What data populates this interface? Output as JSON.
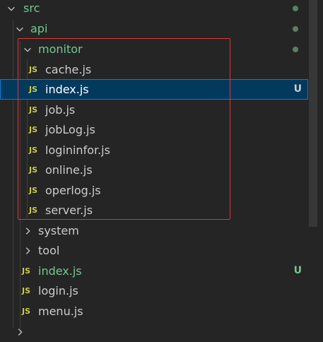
{
  "explorer": {
    "folders": {
      "src": "src",
      "api": "api",
      "monitor": "monitor",
      "system": "system",
      "tool": "tool"
    },
    "monitor_files": [
      {
        "name": "cache.js"
      },
      {
        "name": "index.js",
        "status": "U"
      },
      {
        "name": "job.js"
      },
      {
        "name": "jobLog.js"
      },
      {
        "name": "logininfor.js"
      },
      {
        "name": "online.js"
      },
      {
        "name": "operlog.js"
      },
      {
        "name": "server.js"
      }
    ],
    "api_files": [
      {
        "name": "index.js",
        "status": "U"
      },
      {
        "name": "login.js"
      },
      {
        "name": "menu.js"
      }
    ],
    "file_icon_text": "JS",
    "colors": {
      "untracked_green": "#73c991",
      "js_yellow": "#cbcb41",
      "selection_bg": "#04395e",
      "annotation_red": "#d73a3a"
    }
  }
}
